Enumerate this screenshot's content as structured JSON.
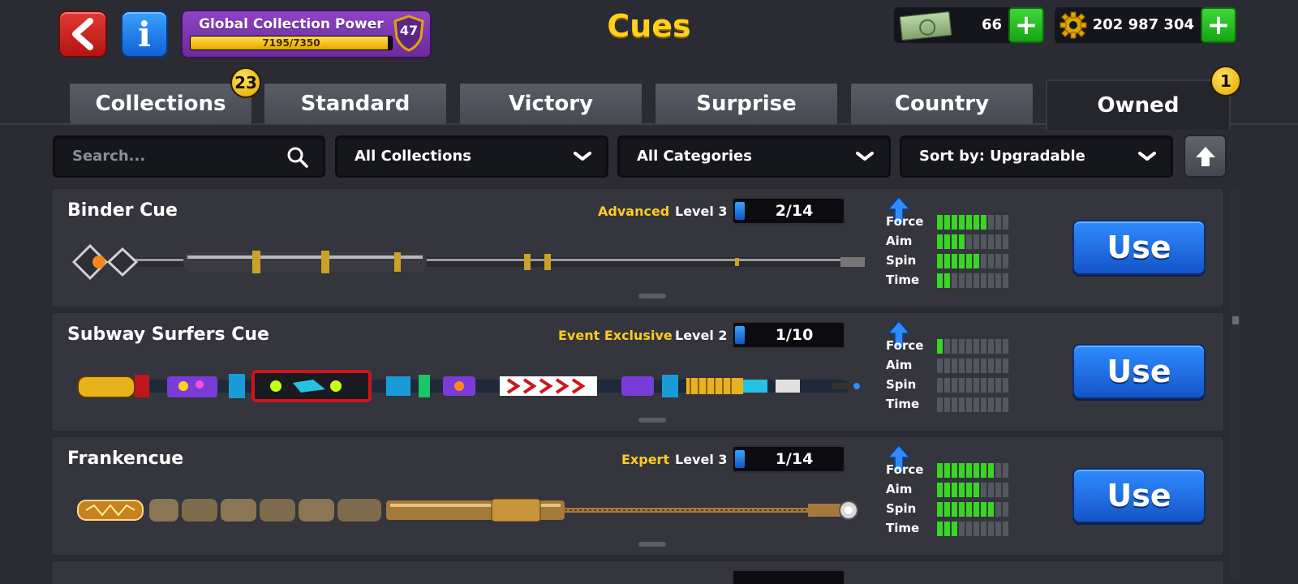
{
  "header": {
    "title": "Cues",
    "power": {
      "label": "Global Collection Power",
      "progress_text": "7195/7350",
      "progress": 0.979,
      "level": "47"
    },
    "cash": {
      "value": "66"
    },
    "coins": {
      "value": "202 987 304"
    }
  },
  "tabs": [
    {
      "label": "Collections",
      "badge": "23"
    },
    {
      "label": "Standard"
    },
    {
      "label": "Victory"
    },
    {
      "label": "Surprise"
    },
    {
      "label": "Country"
    },
    {
      "label": "Owned",
      "badge": "1",
      "active": true
    }
  ],
  "filters": {
    "search_placeholder": "Search...",
    "collection": "All Collections",
    "category": "All Categories",
    "sort": "Sort by: Upgradable"
  },
  "cues": [
    {
      "name": "Binder Cue",
      "rarity": "Advanced",
      "level": "Level 3",
      "progress": "2/14",
      "stats": {
        "force": 7,
        "aim": 4,
        "spin": 6,
        "time": 2
      },
      "action": "Use"
    },
    {
      "name": "Subway Surfers Cue",
      "rarity": "Event Exclusive",
      "level": "Level 2",
      "progress": "1/10",
      "stats": {
        "force": 1,
        "aim": 0,
        "spin": 0,
        "time": 0
      },
      "action": "Use"
    },
    {
      "name": "Frankencue",
      "rarity": "Expert",
      "level": "Level 3",
      "progress": "1/14",
      "stats": {
        "force": 8,
        "aim": 6,
        "spin": 8,
        "time": 3
      },
      "action": "Use"
    }
  ],
  "stat_labels": {
    "force": "Force",
    "aim": "Aim",
    "spin": "Spin",
    "time": "Time"
  },
  "colors": {
    "accent_gold": "#ffd21a",
    "stat_on": "#39d623",
    "use_button": "#1f6fe8",
    "power_purple": "#7b35ac"
  }
}
